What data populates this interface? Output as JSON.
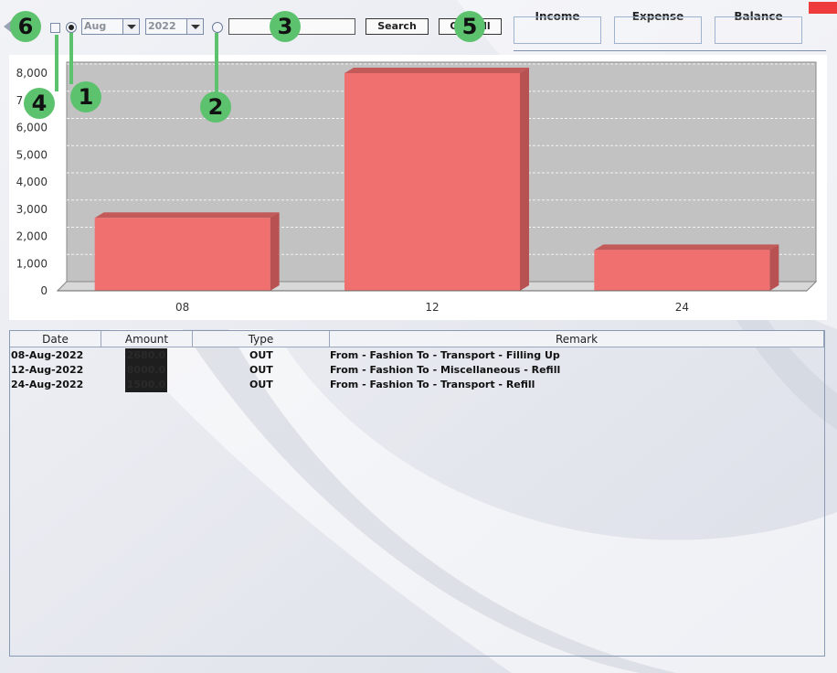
{
  "toolbar": {
    "month_selected": "Aug",
    "year_selected": "2022",
    "search_value": "",
    "search_label": "Search",
    "overall_label": "Overall"
  },
  "stats": {
    "income_label": "Income",
    "expense_label": "Expense",
    "balance_label": "Balance"
  },
  "markers": [
    "6",
    "1",
    "4",
    "2",
    "3",
    "5"
  ],
  "colors": {
    "bar": "#f07070",
    "plot_bg": "#c2c2c2",
    "marker": "#5cc26e",
    "close": "#ee3b3b"
  },
  "chart_data": {
    "type": "bar",
    "categories": [
      "08",
      "12",
      "24"
    ],
    "values": [
      2680,
      8000,
      1500
    ],
    "ylim": [
      0,
      8000
    ],
    "yticks": [
      0,
      1000,
      2000,
      3000,
      4000,
      5000,
      6000,
      7000,
      8000
    ],
    "ytick_labels": [
      "0",
      "1,000",
      "2,000",
      "3,000",
      "4,000",
      "5,000",
      "6,000",
      "7,000",
      "8,000"
    ],
    "grid": true,
    "title": "",
    "xlabel": "",
    "ylabel": ""
  },
  "table": {
    "headers": [
      "Date",
      "Amount",
      "Type",
      "Remark"
    ],
    "rows": [
      {
        "date": "08-Aug-2022",
        "amount": "2680.0",
        "type": "OUT",
        "remark": "From - Fashion To - Transport - Filling Up"
      },
      {
        "date": "12-Aug-2022",
        "amount": "8000.0",
        "type": "OUT",
        "remark": "From - Fashion To - Miscellaneous - Refill"
      },
      {
        "date": "24-Aug-2022",
        "amount": "1500.0",
        "type": "OUT",
        "remark": "From - Fashion To - Transport - Refill"
      }
    ]
  }
}
